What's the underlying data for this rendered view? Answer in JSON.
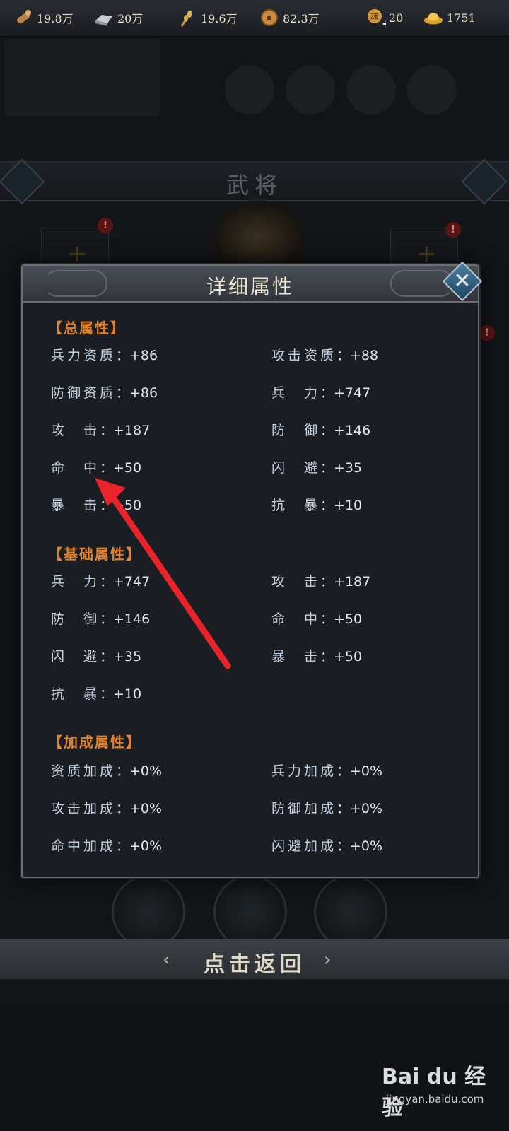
{
  "resources": [
    {
      "icon": "wood-icon",
      "value": "19.8万"
    },
    {
      "icon": "iron-icon",
      "value": "20万"
    },
    {
      "icon": "grain-icon",
      "value": "19.6万"
    },
    {
      "icon": "coin-icon",
      "value": "82.3万"
    },
    {
      "icon": "stamina-icon",
      "value": "20"
    },
    {
      "icon": "gold-ingot-icon",
      "value": "1751"
    }
  ],
  "background": {
    "panel_title": "武将"
  },
  "dialog": {
    "title": "详细属性",
    "sections": [
      {
        "title": "【总属性】",
        "rows": [
          [
            {
              "label": "兵力资质",
              "value": "：+86"
            },
            {
              "label": "攻击资质",
              "value": "：+88"
            }
          ],
          [
            {
              "label": "防御资质",
              "value": "：+86"
            },
            {
              "label": "兵　力",
              "value": "：+747"
            }
          ],
          [
            {
              "label": "攻　击",
              "value": "：+187"
            },
            {
              "label": "防　御",
              "value": "：+146"
            }
          ],
          [
            {
              "label": "命　中",
              "value": "：+50"
            },
            {
              "label": "闪　避",
              "value": "：+35"
            }
          ],
          [
            {
              "label": "暴　击",
              "value": "：+50"
            },
            {
              "label": "抗　暴",
              "value": "：+10"
            }
          ]
        ]
      },
      {
        "title": "【基础属性】",
        "rows": [
          [
            {
              "label": "兵　力",
              "value": "：+747"
            },
            {
              "label": "攻　击",
              "value": "：+187"
            }
          ],
          [
            {
              "label": "防　御",
              "value": "：+146"
            },
            {
              "label": "命　中",
              "value": "：+50"
            }
          ],
          [
            {
              "label": "闪　避",
              "value": "：+35"
            },
            {
              "label": "暴　击",
              "value": "：+50"
            }
          ],
          [
            {
              "label": "抗　暴",
              "value": "：+10"
            }
          ]
        ]
      },
      {
        "title": "【加成属性】",
        "rows": [
          [
            {
              "label": "资质加成",
              "value": "：+0%"
            },
            {
              "label": "兵力加成",
              "value": "：+0%"
            }
          ],
          [
            {
              "label": "攻击加成",
              "value": "：+0%"
            },
            {
              "label": "防御加成",
              "value": "：+0%"
            }
          ],
          [
            {
              "label": "命中加成",
              "value": "：+0%"
            },
            {
              "label": "闪避加成",
              "value": "：+0%"
            }
          ]
        ]
      }
    ]
  },
  "return_button": {
    "label": "点击返回"
  },
  "watermark": {
    "brand": "Bai du 经验",
    "url": "jingyan.baidu.com"
  },
  "colors": {
    "section_title": "#e0822e",
    "attribute_text": "#c6d2e2",
    "annotation_arrow": "#e8232a"
  }
}
